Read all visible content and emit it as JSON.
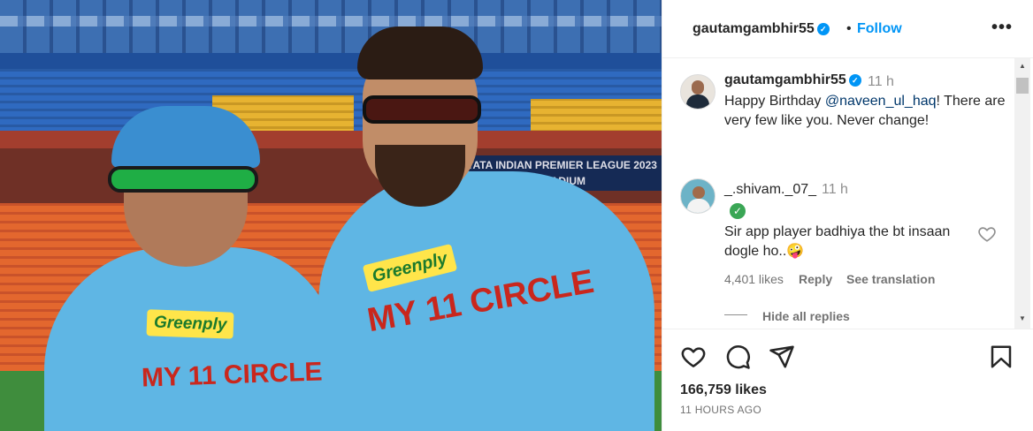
{
  "photo": {
    "scoreboard_text": "TATA INDIAN PREMIER LEAGUE 2023",
    "scoreboard_sub": "ENDRA MODI STADIUM",
    "sponsor_left_player": "Greenply",
    "sponsor_right_player": "Greenply",
    "jersey_left": "MY 11 CIRCLE",
    "jersey_right": "MY 11 CIRCLE"
  },
  "header": {
    "username": "gautamgambhir55",
    "dot": "•",
    "follow_label": "Follow",
    "more_label": "•••"
  },
  "caption": {
    "username": "gautamgambhir55",
    "time": "11 h",
    "text_before": "Happy Birthday ",
    "mention": "@naveen_ul_haq",
    "text_after": "! There are very few like you. Never change!"
  },
  "comment": {
    "username": "_.shivam._07_",
    "time": "11 h",
    "text": "Sir app player badhiya the bt insaan dogle ho..",
    "emoji": "🤪",
    "likes": "4,401 likes",
    "reply_label": "Reply",
    "translate_label": "See translation",
    "hide_replies_label": "Hide all replies"
  },
  "post": {
    "likes": "166,759 likes",
    "date": "11 HOURS AGO"
  },
  "icons": [
    "like-icon",
    "comment-icon",
    "share-icon",
    "save-icon",
    "heart-icon",
    "verified-icon",
    "more-icon"
  ],
  "colors": {
    "accent": "#0095f6",
    "text": "#262626",
    "muted": "#737373"
  }
}
